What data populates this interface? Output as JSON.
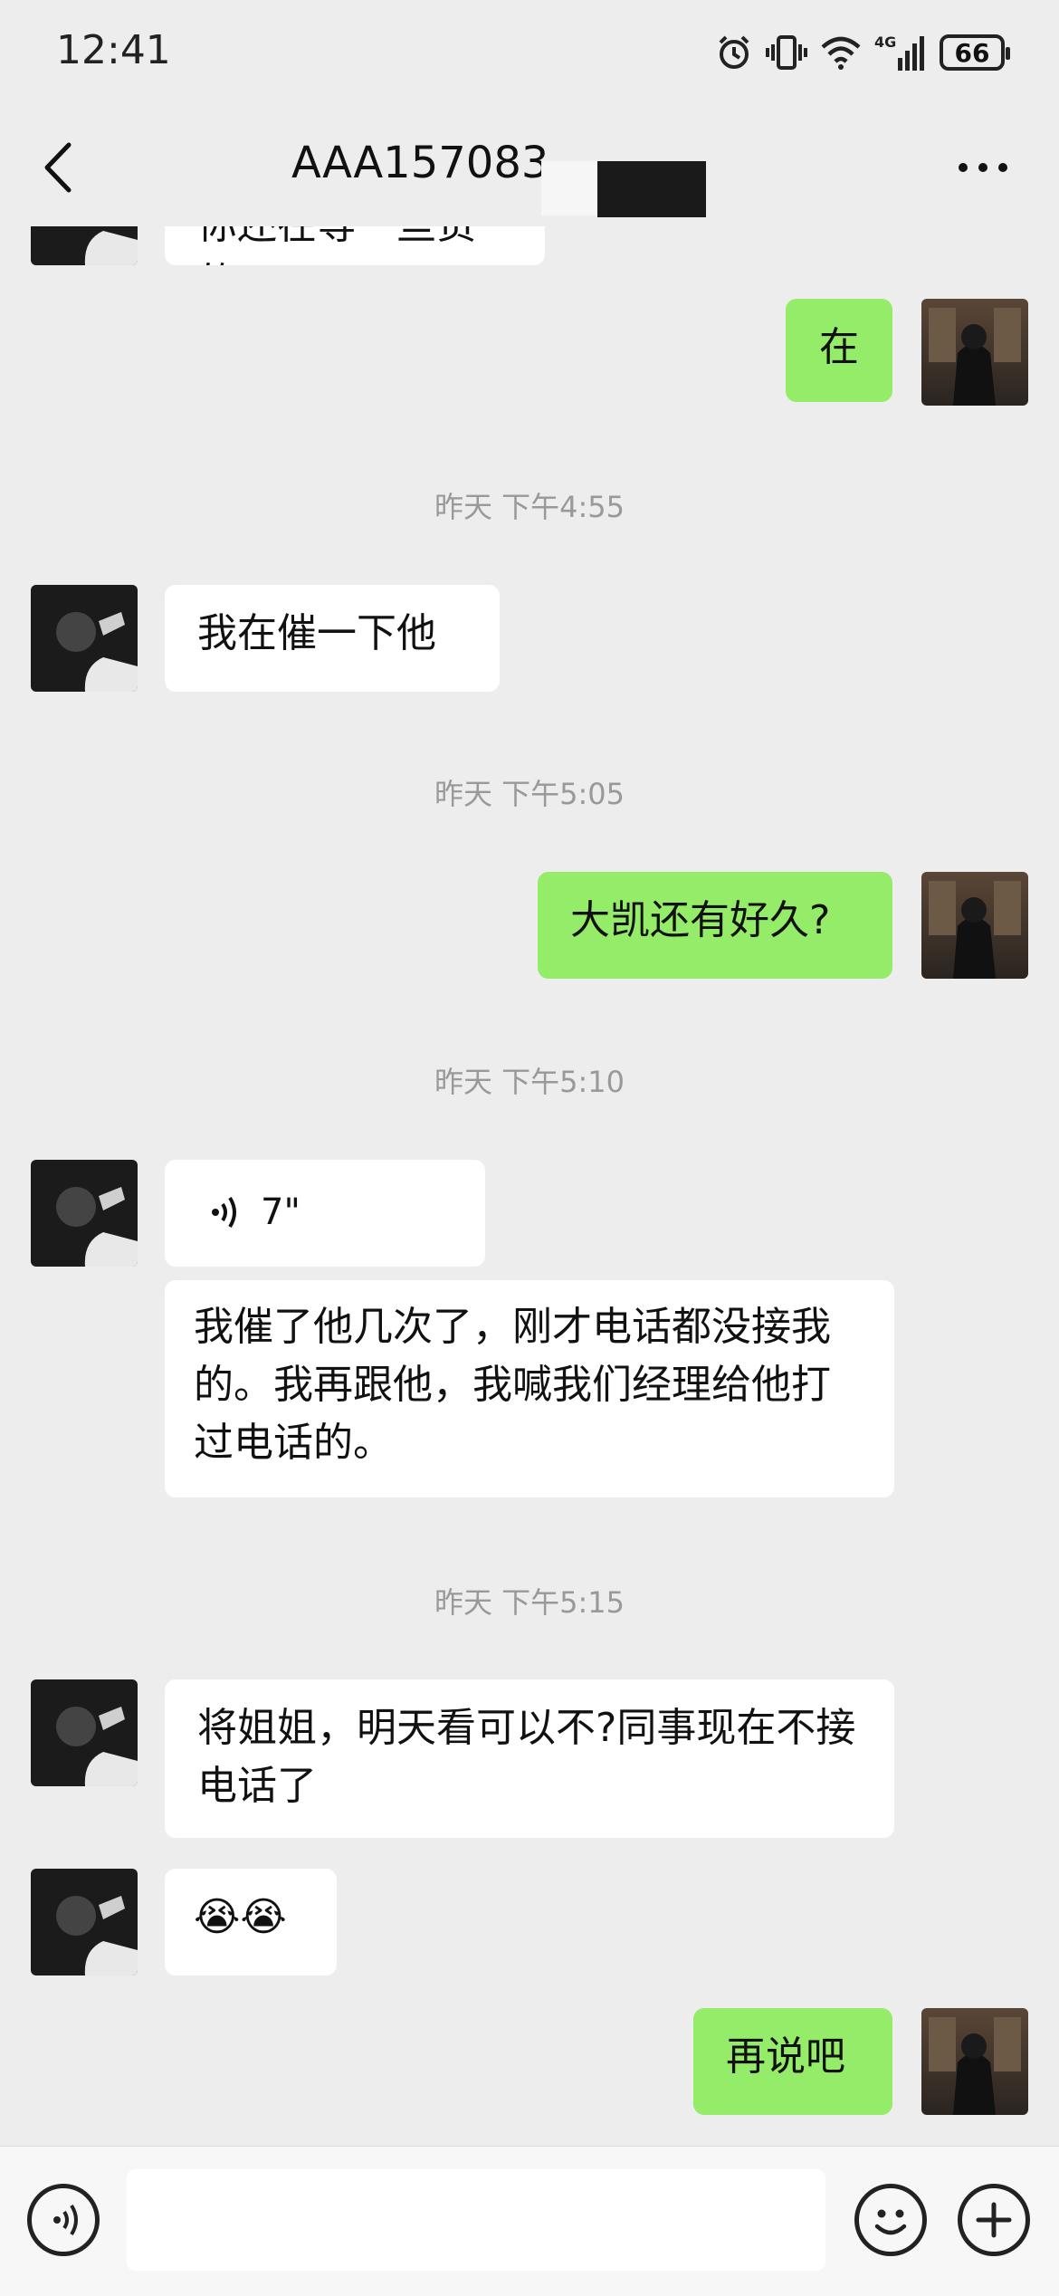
{
  "status_bar": {
    "time": "12:41",
    "battery": "66",
    "network": "4G"
  },
  "header": {
    "title": "AAA157083"
  },
  "messages": {
    "m0_partial": "你还在等一些货的",
    "m1_out": "在",
    "ts1": "昨天 下午4:55",
    "m2_in": "我在催一下他",
    "ts2": "昨天 下午5:05",
    "m3_out": "大凯还有好久?",
    "ts3": "昨天 下午5:10",
    "voice_duration": "7\"",
    "m5_in": "我催了他几次了，刚才电话都没接我的。我再跟他，我喊我们经理给他打过电话的。",
    "ts4": "昨天 下午5:15",
    "m6_in": "将姐姐，明天看可以不?同事现在不接电话了",
    "m7_emoji": "😭😭",
    "m8_out": "再说吧"
  },
  "colors": {
    "outgoing_bubble": "#95ec69",
    "incoming_bubble": "#ffffff",
    "background": "#ededed"
  },
  "icons": [
    "alarm-icon",
    "vibrate-icon",
    "wifi-icon",
    "signal-icon",
    "battery-icon",
    "back-icon",
    "more-icon",
    "voice-input-icon",
    "emoji-icon",
    "plus-icon",
    "voice-wave-icon"
  ]
}
